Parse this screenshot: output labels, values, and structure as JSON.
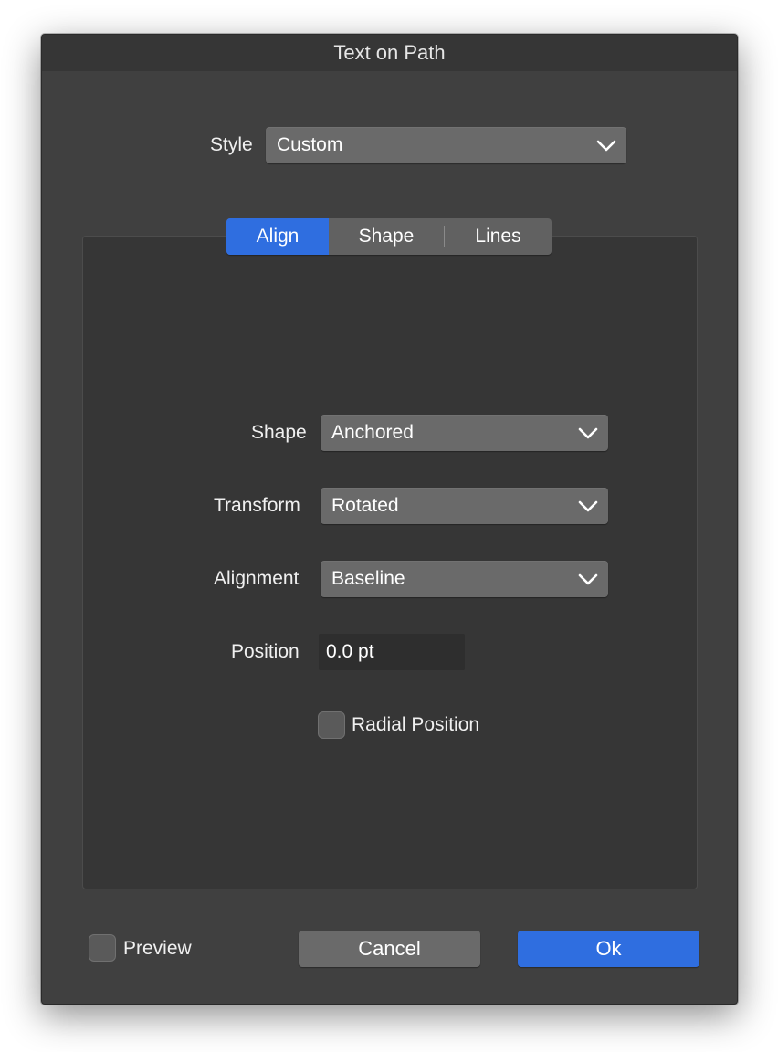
{
  "window": {
    "title": "Text on Path"
  },
  "style": {
    "label": "Style",
    "value": "Custom"
  },
  "tabs": [
    {
      "label": "Align",
      "active": true
    },
    {
      "label": "Shape",
      "active": false
    },
    {
      "label": "Lines",
      "active": false
    }
  ],
  "align_panel": {
    "shape": {
      "label": "Shape",
      "value": "Anchored"
    },
    "transform": {
      "label": "Transform",
      "value": "Rotated"
    },
    "alignment": {
      "label": "Alignment",
      "value": "Baseline"
    },
    "position": {
      "label": "Position",
      "value": "0.0 pt"
    },
    "radial_position": {
      "label": "Radial Position",
      "checked": false
    }
  },
  "footer": {
    "preview": {
      "label": "Preview",
      "checked": false
    },
    "cancel_label": "Cancel",
    "ok_label": "Ok"
  },
  "colors": {
    "window_bg": "#404040",
    "titlebar_bg": "#363636",
    "panel_bg": "#363636",
    "accent": "#2f6ee0",
    "control_bg": "#6a6a6a"
  },
  "icons": {
    "dropdown": "chevron-down-icon"
  }
}
